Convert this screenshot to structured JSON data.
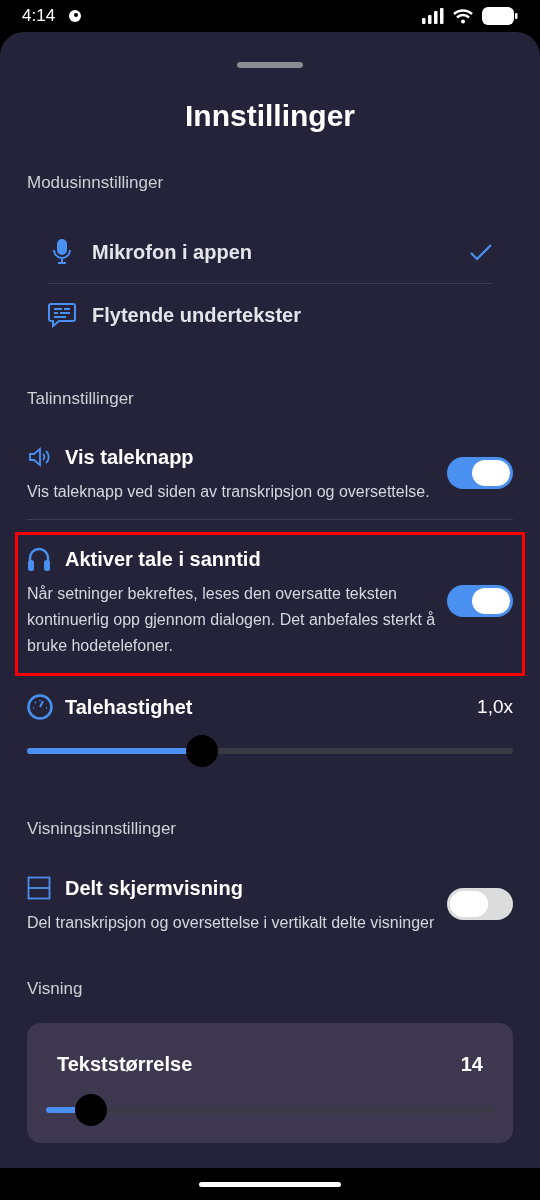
{
  "status_bar": {
    "time": "4:14"
  },
  "title": "Innstillinger",
  "mode_section": {
    "label": "Modusinnstillinger",
    "items": [
      {
        "kind": "microphone",
        "label": "Mikrofon i appen",
        "selected": true
      },
      {
        "kind": "subtitles",
        "label": "Flytende undertekster",
        "selected": false
      }
    ]
  },
  "speech_section": {
    "label": "Talinnstillinger",
    "items": [
      {
        "kind": "speaker",
        "title": "Vis taleknapp",
        "description": "Vis taleknapp ved siden av transkripsjon og oversettelse.",
        "on": true,
        "highlighted": false
      },
      {
        "kind": "headphones",
        "title": "Aktiver tale i sanntid",
        "description": "Når setninger bekreftes, leses den oversatte teksten kontinuerlig opp gjennom dialogen. Det anbefales sterkt å bruke hodetelefoner.",
        "on": true,
        "highlighted": true
      }
    ],
    "speed": {
      "title": "Talehastighet",
      "reading": "1,0x",
      "level": 0.36
    }
  },
  "display_section": {
    "label": "Visningsinnstillinger",
    "items": [
      {
        "kind": "split",
        "title": "Delt skjermvisning",
        "description": "Del transkripsjon og oversettelse i vertikalt delte visninger",
        "on": false,
        "highlighted": false
      }
    ]
  },
  "view_section": {
    "label": "Visning",
    "text_size": {
      "title": "Tekststørrelse",
      "reading": "14",
      "level": 0.1
    }
  }
}
